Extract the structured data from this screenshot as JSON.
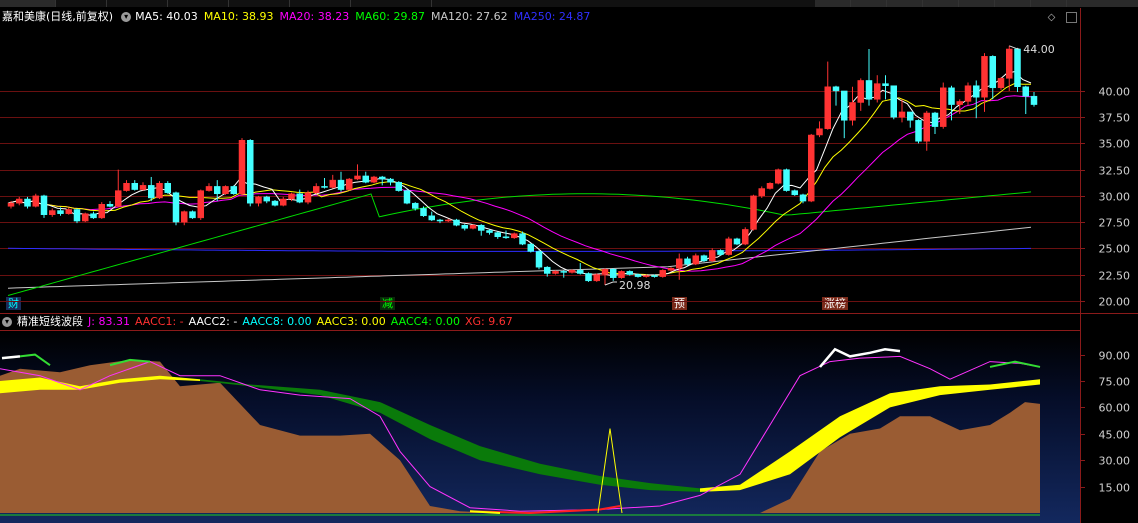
{
  "toolbar": {
    "right_buttons": [
      "",
      "",
      "",
      "",
      "",
      "",
      "",
      ""
    ]
  },
  "header": {
    "stock_title": "嘉和美康(日线,前复权)",
    "ma": [
      {
        "label": "MA5: 40.03",
        "color": "#ffffff"
      },
      {
        "label": "MA10: 38.93",
        "color": "#ffff00"
      },
      {
        "label": "MA20: 38.23",
        "color": "#ff00ff"
      },
      {
        "label": "MA60: 29.87",
        "color": "#00ff00"
      },
      {
        "label": "MA120: 27.62",
        "color": "#c8c8c8"
      },
      {
        "label": "MA250: 24.87",
        "color": "#3030ff"
      }
    ]
  },
  "price_axis": [
    "40.00",
    "37.50",
    "35.00",
    "32.50",
    "30.00",
    "27.50",
    "25.00",
    "22.50",
    "20.00"
  ],
  "price_annotations": {
    "high": "44.00",
    "low": "20.98"
  },
  "events": [
    {
      "label": "财",
      "color": "#00ffff",
      "bg": "#1a2a5a"
    },
    {
      "label": "减",
      "color": "#00ff00",
      "bg": "#0a2a0a"
    },
    {
      "label": "预",
      "color": "#ffffff",
      "bg": "#7a2a1a"
    },
    {
      "label": "涨榜",
      "color": "#ffffff",
      "bg": "#7a2a1a"
    }
  ],
  "indicator": {
    "name": "精准短线波段",
    "values": [
      {
        "label": "J: 83.31",
        "color": "#ff00ff"
      },
      {
        "label": "AACC1: -",
        "color": "#ff3030"
      },
      {
        "label": "AACC2: -",
        "color": "#ffffff"
      },
      {
        "label": "AACC8: 0.00",
        "color": "#00ffff"
      },
      {
        "label": "AACC3: 0.00",
        "color": "#ffff00"
      },
      {
        "label": "AACC4: 0.00",
        "color": "#00ff00"
      },
      {
        "label": "XG: 9.67",
        "color": "#ff3030"
      }
    ],
    "axis": [
      "90.00",
      "75.00",
      "60.00",
      "45.00",
      "30.00",
      "15.00"
    ]
  },
  "colors": {
    "up": "#ff3333",
    "down": "#44ffff",
    "frame": "#8a1a1a",
    "hline": "#6a1010"
  },
  "chart_data": {
    "type": "candlestick",
    "ylim": [
      19.5,
      46.0
    ],
    "yticks": [
      20.0,
      22.5,
      25.0,
      27.5,
      30.0,
      32.5,
      35.0,
      37.5,
      40.0
    ],
    "candles": [
      [
        29.0,
        29.3,
        28.8,
        29.5
      ],
      [
        29.3,
        29.7,
        29.1,
        29.9
      ],
      [
        29.7,
        29.0,
        28.8,
        29.9
      ],
      [
        29.0,
        30.0,
        28.9,
        30.2
      ],
      [
        30.0,
        28.2,
        27.9,
        30.1
      ],
      [
        28.2,
        28.6,
        28.0,
        28.8
      ],
      [
        28.6,
        28.3,
        28.1,
        28.9
      ],
      [
        28.3,
        28.7,
        28.2,
        28.9
      ],
      [
        28.7,
        27.6,
        27.4,
        28.8
      ],
      [
        27.6,
        28.3,
        27.5,
        28.4
      ],
      [
        28.3,
        27.9,
        27.8,
        28.5
      ],
      [
        27.9,
        29.2,
        27.8,
        29.4
      ],
      [
        29.2,
        29.0,
        28.9,
        29.5
      ],
      [
        29.0,
        30.5,
        28.9,
        32.5
      ],
      [
        30.5,
        31.2,
        30.4,
        31.5
      ],
      [
        31.2,
        30.6,
        30.5,
        31.5
      ],
      [
        30.6,
        31.0,
        30.5,
        31.3
      ],
      [
        31.0,
        29.8,
        29.5,
        31.8
      ],
      [
        29.8,
        31.2,
        29.7,
        31.4
      ],
      [
        31.2,
        30.3,
        30.2,
        31.4
      ],
      [
        30.3,
        27.5,
        27.2,
        30.4
      ],
      [
        27.5,
        28.5,
        27.2,
        28.6
      ],
      [
        28.5,
        27.9,
        27.8,
        28.6
      ],
      [
        27.9,
        30.5,
        27.7,
        30.6
      ],
      [
        30.5,
        30.9,
        30.4,
        31.2
      ],
      [
        30.9,
        30.2,
        29.5,
        31.5
      ],
      [
        30.2,
        30.9,
        30.1,
        31.0
      ],
      [
        30.9,
        30.2,
        30.1,
        31.0
      ],
      [
        30.2,
        35.3,
        30.0,
        35.5
      ],
      [
        35.3,
        29.3,
        29.0,
        35.4
      ],
      [
        29.3,
        29.9,
        29.0,
        30.0
      ],
      [
        29.9,
        29.5,
        29.3,
        30.0
      ],
      [
        29.5,
        29.1,
        29.0,
        29.6
      ],
      [
        29.1,
        29.7,
        29.0,
        29.9
      ],
      [
        29.7,
        30.2,
        29.5,
        30.3
      ],
      [
        30.2,
        29.4,
        29.3,
        30.6
      ],
      [
        29.4,
        30.3,
        29.2,
        30.5
      ],
      [
        30.3,
        30.9,
        30.2,
        31.2
      ],
      [
        30.9,
        30.8,
        30.7,
        31.7
      ],
      [
        30.8,
        31.5,
        30.7,
        32.0
      ],
      [
        31.5,
        30.6,
        30.4,
        32.3
      ],
      [
        30.6,
        31.6,
        30.5,
        31.7
      ],
      [
        31.6,
        31.9,
        31.5,
        33.0
      ],
      [
        31.9,
        31.3,
        31.2,
        32.3
      ],
      [
        31.3,
        31.8,
        31.2,
        31.9
      ],
      [
        31.8,
        31.6,
        31.0,
        31.9
      ],
      [
        31.6,
        31.3,
        31.0,
        31.7
      ],
      [
        31.3,
        30.5,
        30.4,
        31.4
      ],
      [
        30.5,
        29.3,
        29.2,
        30.6
      ],
      [
        29.3,
        28.8,
        28.6,
        29.4
      ],
      [
        28.8,
        28.1,
        28.0,
        29.0
      ],
      [
        28.1,
        27.7,
        27.6,
        28.5
      ],
      [
        27.7,
        27.6,
        27.4,
        27.8
      ],
      [
        27.6,
        27.7,
        27.5,
        27.8
      ],
      [
        27.7,
        27.2,
        27.1,
        27.8
      ],
      [
        27.2,
        26.9,
        26.7,
        27.3
      ],
      [
        26.9,
        27.2,
        26.8,
        27.3
      ],
      [
        27.2,
        26.7,
        26.2,
        27.3
      ],
      [
        26.7,
        26.5,
        26.3,
        26.8
      ],
      [
        26.5,
        26.1,
        25.9,
        26.6
      ],
      [
        26.1,
        26.0,
        25.9,
        26.7
      ],
      [
        26.0,
        26.4,
        25.9,
        26.5
      ],
      [
        26.4,
        25.4,
        25.3,
        26.6
      ],
      [
        25.4,
        24.7,
        24.6,
        25.5
      ],
      [
        24.7,
        23.2,
        23.0,
        24.8
      ],
      [
        23.2,
        22.6,
        22.3,
        23.3
      ],
      [
        22.6,
        22.8,
        22.5,
        22.9
      ],
      [
        22.8,
        22.7,
        22.2,
        22.9
      ],
      [
        22.7,
        22.9,
        22.6,
        23.0
      ],
      [
        22.9,
        22.6,
        22.5,
        23.6
      ],
      [
        22.6,
        21.9,
        21.8,
        22.7
      ],
      [
        21.9,
        22.5,
        21.8,
        22.6
      ],
      [
        22.5,
        23.0,
        21.5,
        23.1
      ],
      [
        23.0,
        22.2,
        21.9,
        23.1
      ],
      [
        22.2,
        22.8,
        22.1,
        22.9
      ],
      [
        22.8,
        22.5,
        22.4,
        22.9
      ],
      [
        22.5,
        22.3,
        22.2,
        22.6
      ],
      [
        22.3,
        22.4,
        22.2,
        22.5
      ],
      [
        22.4,
        22.3,
        22.2,
        22.5
      ],
      [
        22.3,
        22.9,
        22.2,
        23.0
      ],
      [
        22.9,
        23.1,
        22.8,
        23.2
      ],
      [
        23.1,
        24.0,
        22.0,
        24.5
      ],
      [
        24.0,
        23.5,
        23.3,
        24.2
      ],
      [
        23.5,
        24.3,
        23.4,
        24.5
      ],
      [
        24.3,
        23.8,
        23.7,
        24.4
      ],
      [
        23.8,
        24.8,
        23.7,
        25.0
      ],
      [
        24.8,
        24.4,
        24.3,
        24.9
      ],
      [
        24.4,
        25.9,
        24.3,
        26.1
      ],
      [
        25.9,
        25.4,
        25.3,
        26.0
      ],
      [
        25.4,
        26.8,
        25.3,
        27.0
      ],
      [
        26.8,
        30.0,
        26.7,
        30.1
      ],
      [
        30.0,
        30.7,
        29.8,
        30.9
      ],
      [
        30.7,
        31.2,
        30.6,
        31.3
      ],
      [
        31.2,
        32.5,
        31.1,
        32.6
      ],
      [
        32.5,
        30.5,
        30.4,
        32.6
      ],
      [
        30.5,
        30.1,
        30.0,
        30.6
      ],
      [
        30.1,
        29.5,
        29.3,
        30.2
      ],
      [
        29.5,
        35.8,
        29.4,
        35.9
      ],
      [
        35.8,
        36.4,
        35.6,
        37.1
      ],
      [
        36.4,
        40.4,
        36.3,
        42.8
      ],
      [
        40.4,
        40.0,
        38.6,
        40.5
      ],
      [
        40.0,
        37.2,
        35.5,
        38.8
      ],
      [
        37.2,
        38.9,
        36.7,
        40.4
      ],
      [
        38.9,
        41.0,
        38.1,
        41.2
      ],
      [
        41.0,
        39.2,
        38.6,
        44.0
      ],
      [
        39.2,
        40.7,
        38.9,
        41.5
      ],
      [
        40.7,
        40.5,
        39.2,
        41.5
      ],
      [
        40.5,
        37.5,
        37.3,
        38.0
      ],
      [
        37.5,
        38.0,
        37.0,
        39.2
      ],
      [
        38.0,
        37.2,
        36.5,
        38.0
      ],
      [
        37.2,
        35.2,
        35.0,
        37.3
      ],
      [
        35.2,
        37.9,
        34.3,
        38.1
      ],
      [
        37.9,
        36.6,
        35.9,
        38.0
      ],
      [
        36.6,
        40.3,
        36.4,
        40.8
      ],
      [
        40.3,
        38.7,
        37.2,
        40.5
      ],
      [
        38.7,
        39.0,
        37.8,
        39.2
      ],
      [
        39.0,
        40.5,
        38.6,
        40.8
      ],
      [
        40.5,
        39.4,
        37.4,
        41.0
      ],
      [
        39.4,
        43.3,
        38.0,
        43.6
      ],
      [
        43.3,
        40.3,
        39.2,
        43.4
      ],
      [
        40.3,
        41.2,
        40.1,
        41.3
      ],
      [
        41.2,
        44.0,
        40.0,
        44.3
      ],
      [
        44.0,
        40.4,
        39.9,
        44.1
      ],
      [
        40.4,
        39.5,
        37.8,
        40.5
      ],
      [
        39.5,
        38.7,
        38.5,
        39.9
      ]
    ]
  }
}
